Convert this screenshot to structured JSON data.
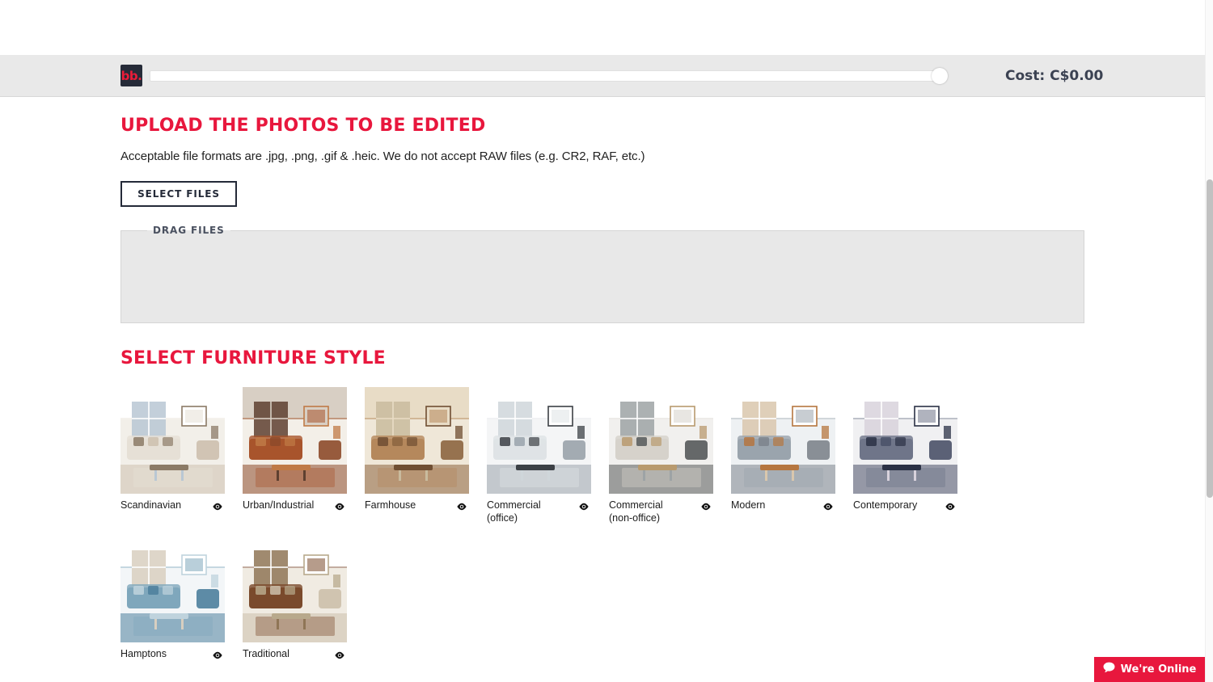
{
  "header": {
    "logo_text": "bb.",
    "logo_name": "bb-logo",
    "progress_value": 100,
    "cost_label": "Cost: C$0.00"
  },
  "upload": {
    "title": "UPLOAD THE PHOTOS TO BE EDITED",
    "format_note": "Acceptable file formats are .jpg, .png, .gif & .heic. We do not accept RAW files (e.g. CR2, RAF, etc.)",
    "select_files_label": "SELECT FILES",
    "drag_legend": "DRAG FILES"
  },
  "furniture": {
    "title": "SELECT FURNITURE STYLE",
    "preview_icon": "eye-icon",
    "styles": [
      {
        "label": "Scandinavian",
        "palette": [
          "#f2efe9",
          "#e6e0d6",
          "#cdbfae",
          "#8b7a66",
          "#b9c7d4",
          "#ffffff"
        ]
      },
      {
        "label": "Urban/Industrial",
        "palette": [
          "#f3efe8",
          "#a8542c",
          "#8d4a2a",
          "#c07a46",
          "#5e4030",
          "#d8cfc4"
        ]
      },
      {
        "label": "Farmhouse",
        "palette": [
          "#efe7d8",
          "#b5885c",
          "#8c6540",
          "#6f4e32",
          "#c9bb9e",
          "#e8dcc6"
        ]
      },
      {
        "label": "Commercial\n(office)",
        "palette": [
          "#f4f5f6",
          "#dfe3e6",
          "#9aa3ab",
          "#3c4045",
          "#cfd6da",
          "#ffffff"
        ]
      },
      {
        "label": "Commercial\n(non-office)",
        "palette": [
          "#f1f0ee",
          "#d6d2cb",
          "#55595a",
          "#b89a6e",
          "#9da3a5",
          "#ffffff"
        ]
      },
      {
        "label": "Modern",
        "palette": [
          "#eef1f3",
          "#9aa4ad",
          "#7d848c",
          "#b5763f",
          "#d9c7ad",
          "#ffffff"
        ]
      },
      {
        "label": "Contemporary",
        "palette": [
          "#f0f0f2",
          "#6f7589",
          "#4a5168",
          "#2b3145",
          "#d8d2dc",
          "#ffffff"
        ]
      },
      {
        "label": "Hamptons",
        "palette": [
          "#f3f6f8",
          "#7fa7bc",
          "#4c7f9c",
          "#bfd3dd",
          "#d8cfc0",
          "#ffffff"
        ]
      },
      {
        "label": "Traditional",
        "palette": [
          "#f0ebe2",
          "#7a4a2c",
          "#ccc0ab",
          "#b8a98c",
          "#8f7556",
          "#ffffff"
        ]
      }
    ]
  },
  "chat": {
    "label": "We're Online",
    "icon": "chat-bubble-icon"
  }
}
